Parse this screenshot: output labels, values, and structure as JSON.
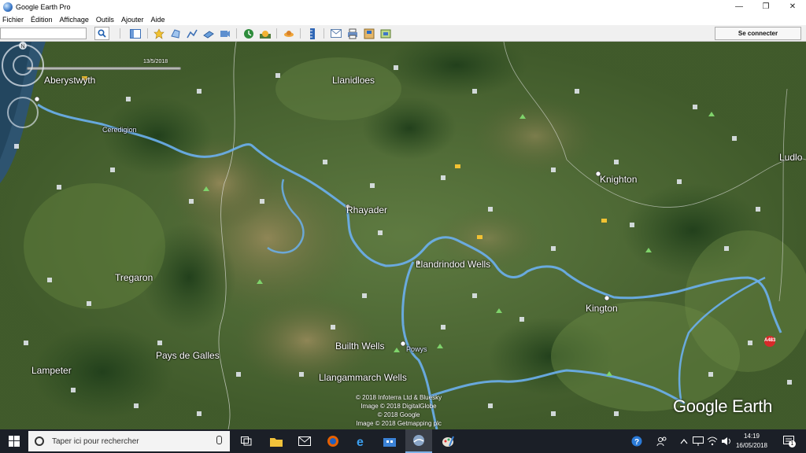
{
  "window": {
    "title": "Google Earth Pro",
    "minimize": "—",
    "maximize": "❐",
    "close": "✕"
  },
  "menu": [
    "Fichier",
    "Édition",
    "Affichage",
    "Outils",
    "Ajouter",
    "Aide"
  ],
  "toolbar": {
    "search_value": "",
    "signin_label": "Se connecter",
    "icons": [
      "sidebar-toggle-icon",
      "add-placemark-icon",
      "add-polygon-icon",
      "add-path-icon",
      "add-overlay-icon",
      "record-tour-icon",
      "historical-imagery-icon",
      "sunlight-icon",
      "planets-icon",
      "ruler-icon",
      "email-icon",
      "print-icon",
      "save-image-icon",
      "view-in-maps-icon"
    ]
  },
  "map": {
    "timeslider_date": "13/5/2018",
    "places": {
      "aberystwyth": "Aberystwyth",
      "llanidloes": "Llanidloes",
      "ceredigion": "Ceredigion",
      "rhayader": "Rhayader",
      "knighton": "Knighton",
      "ludlow": "Ludlo",
      "tregaron": "Tregaron",
      "llandrindod": "Llandrindod Wells",
      "kington": "Kington",
      "builth": "Builth Wells",
      "powys": "Powys",
      "pays_de_galles": "Pays de Galles",
      "lampeter": "Lampeter",
      "llangammarch": "Llangammarch Wells"
    },
    "road_badge": "A483",
    "attribution": [
      "© 2018 Infoterra Ltd & Bluesky",
      "Image © 2018 DigitalGlobe",
      "© 2018 Google",
      "Image © 2018 Getmapping plc"
    ],
    "logo": "Google Earth",
    "compass_n": "N"
  },
  "taskbar": {
    "search_placeholder": "Taper ici pour rechercher",
    "time": "14:19",
    "date": "16/05/2018",
    "notifications": "1",
    "apps": [
      "task-view-icon",
      "file-explorer-icon",
      "mail-icon",
      "firefox-icon",
      "edge-icon",
      "store-icon",
      "google-earth-icon",
      "paint-icon"
    ],
    "accent": "#7fb2e8"
  }
}
